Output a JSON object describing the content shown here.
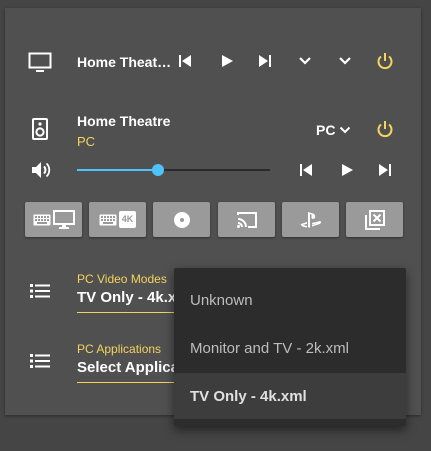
{
  "card1": {
    "title": "Home Theat…"
  },
  "card2": {
    "title": "Home Theatre",
    "source": "PC",
    "source_select": "PC",
    "volume_fraction": 0.42
  },
  "buttons": [
    {
      "name": "keyboard-monitor-button",
      "icon": "keyboard-monitor-icon"
    },
    {
      "name": "keyboard-4k-button",
      "icon": "keyboard-4k-icon",
      "badge": "4K"
    },
    {
      "name": "disc-button",
      "icon": "disc-icon"
    },
    {
      "name": "cast-button",
      "icon": "cast-icon"
    },
    {
      "name": "playstation-button",
      "icon": "playstation-icon"
    },
    {
      "name": "close-box-button",
      "icon": "close-box-icon"
    }
  ],
  "video_modes": {
    "label": "PC Video Modes",
    "value": "TV Only - 4k.xml"
  },
  "applications": {
    "label": "PC Applications",
    "value": "Select Application"
  },
  "menu": {
    "items": [
      {
        "label": "Unknown"
      },
      {
        "label": "Monitor and TV - 2k.xml"
      },
      {
        "label": "TV Only - 4k.xml"
      }
    ],
    "selected_index": 2
  },
  "colors": {
    "accent": "#f4d35e",
    "slider": "#4fc3f7",
    "card": "#505050",
    "button": "#9a9a9a"
  }
}
